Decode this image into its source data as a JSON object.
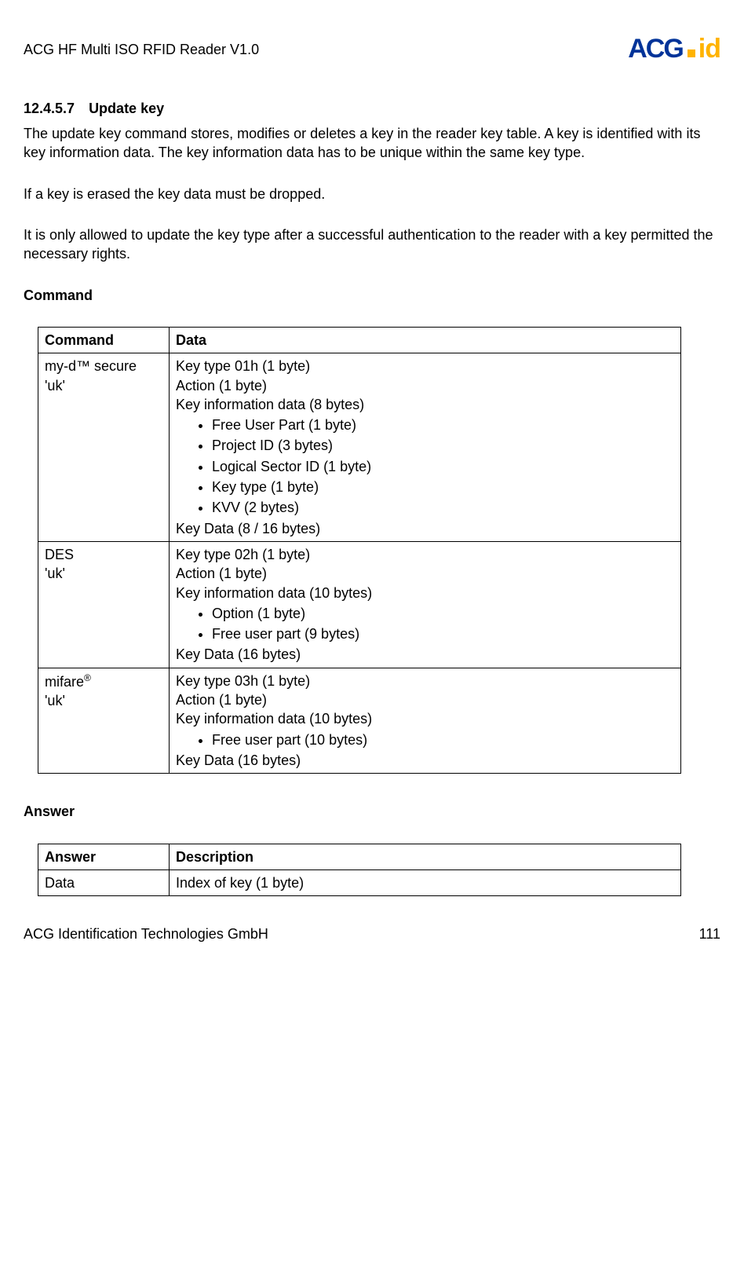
{
  "header": {
    "docTitle": "ACG HF Multi ISO RFID Reader V1.0",
    "logoMain": "ACG",
    "logoSub": "id"
  },
  "section": {
    "number": "12.4.5.7",
    "title": "Update key"
  },
  "para1": "The update key command stores, modifies or deletes a key in the reader key table. A key is identified with its key information data. The key information data has to be unique within the same key type.",
  "para2": "If a key is erased the key data must be dropped.",
  "para3": "It is only allowed to update the key type after a successful authentication to the reader with a key permitted the necessary rights.",
  "commandLabel": "Command",
  "table1": {
    "h1": "Command",
    "h2": "Data",
    "r1c1a": "my-d™ secure",
    "r1c1b": "'uk'",
    "r1l1": "Key type 01h (1 byte)",
    "r1l2": "Action (1 byte)",
    "r1l3": "Key information data (8 bytes)",
    "r1b1": "Free User Part (1 byte)",
    "r1b2": "Project ID (3 bytes)",
    "r1b3": "Logical Sector ID (1 byte)",
    "r1b4": "Key type (1 byte)",
    "r1b5": "KVV (2 bytes)",
    "r1l4": "Key Data (8 / 16 bytes)",
    "r2c1a": "DES",
    "r2c1b": "'uk'",
    "r2l1": "Key type 02h (1 byte)",
    "r2l2": "Action (1 byte)",
    "r2l3": "Key information data (10 bytes)",
    "r2b1": "Option (1 byte)",
    "r2b2": "Free user part (9 bytes)",
    "r2l4": "Key Data (16 bytes)",
    "r3c1a": "mifare",
    "r3c1sup": "®",
    "r3c1b": "'uk'",
    "r3l1": "Key type 03h (1 byte)",
    "r3l2": "Action (1 byte)",
    "r3l3": "Key information data (10 bytes)",
    "r3b1": "Free user part (10 bytes)",
    "r3l4": "Key Data (16 bytes)"
  },
  "answerLabel": "Answer",
  "table2": {
    "h1": "Answer",
    "h2": "Description",
    "r1c1": "Data",
    "r1c2": "Index of key (1 byte)"
  },
  "footer": {
    "left": "ACG Identification Technologies GmbH",
    "right": "111"
  }
}
